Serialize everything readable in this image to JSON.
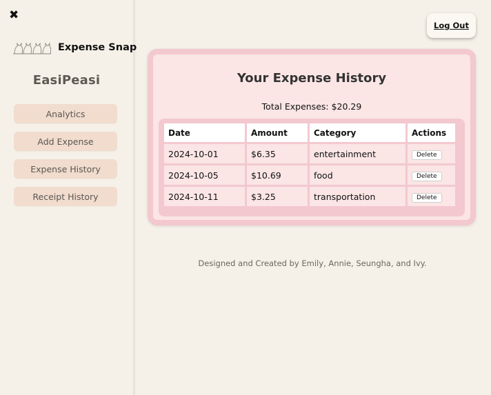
{
  "sidebar": {
    "brand_name": "Expense Snap",
    "app_title": "EasiPeasi",
    "nav": [
      {
        "label": "Analytics"
      },
      {
        "label": "Add Expense"
      },
      {
        "label": "Expense History"
      },
      {
        "label": "Receipt History"
      }
    ],
    "close_icon": "close-icon"
  },
  "header": {
    "logout_label": "Log Out"
  },
  "main": {
    "title": "Your Expense History",
    "total": "Total Expenses: $20.29",
    "table": {
      "headers": [
        "Date",
        "Amount",
        "Category",
        "Actions"
      ],
      "rows": [
        {
          "date": "2024-10-01",
          "amount": "$6.35",
          "category": "entertainment",
          "action": "Delete"
        },
        {
          "date": "2024-10-05",
          "amount": "$10.69",
          "category": "food",
          "action": "Delete"
        },
        {
          "date": "2024-10-11",
          "amount": "$3.25",
          "category": "transportation",
          "action": "Delete"
        }
      ]
    }
  },
  "footer": {
    "credit": "Designed and Created by Emily, Annie, Seungha, and Ivy."
  },
  "colors": {
    "background": "#f6f1e8",
    "nav_button": "#f1dccd",
    "card": "#fbe5e5",
    "card_border": "#f3c8cf"
  }
}
